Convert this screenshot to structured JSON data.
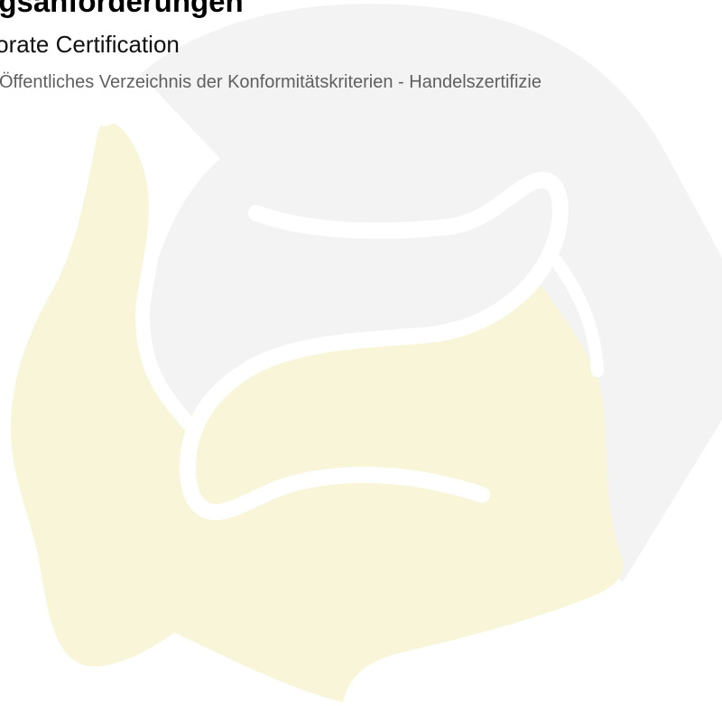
{
  "header": {
    "title": "ungsanforderungen",
    "subtitle": "rporate Certification",
    "registry_line": "Öffentliches Verzeichnis der Konformitätskriterien - Handelszertifizie"
  },
  "watermark": {
    "icon": "handshake-icon",
    "colors": {
      "gray_shape": "#f3f3f3",
      "yellow_shape": "#f8f5d8",
      "outline": "#ffffff"
    }
  }
}
